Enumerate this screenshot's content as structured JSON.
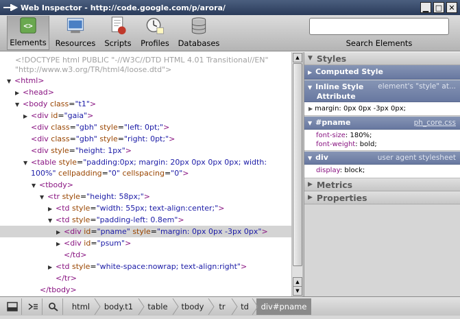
{
  "window": {
    "title": "Web Inspector - http://code.google.com/p/arora/"
  },
  "toolbar": {
    "tabs": [
      {
        "label": "Elements",
        "icon": "elements-icon"
      },
      {
        "label": "Resources",
        "icon": "resources-icon"
      },
      {
        "label": "Scripts",
        "icon": "scripts-icon"
      },
      {
        "label": "Profiles",
        "icon": "profiles-icon"
      },
      {
        "label": "Databases",
        "icon": "databases-icon"
      }
    ],
    "search_label": "Search Elements",
    "search_value": ""
  },
  "tree": {
    "doctype_1": "<!DOCTYPE html PUBLIC \"-//W3C//DTD HTML 4.01 Transitional//EN\"",
    "doctype_2": "\"http://www.w3.org/TR/html4/loose.dtd\">",
    "html": "html",
    "head": "head",
    "body": "body",
    "body_class_attr": "class",
    "body_class_val": "\"t1\"",
    "div_gaia_attr": "id",
    "div_gaia_val": "\"gaia\"",
    "gbh1_attr": "class",
    "gbh1_val": "\"gbh\"",
    "gbh1_style_attr": "style",
    "gbh1_style_val": "\"left: 0pt;\"",
    "gbh2_attr": "class",
    "gbh2_val": "\"gbh\"",
    "gbh2_style_attr": "style",
    "gbh2_style_val": "\"right: 0pt;\"",
    "div_height_attr": "style",
    "div_height_val": "\"height: 1px\"",
    "table_style_attr": "style",
    "table_style_val_1": "\"padding:0px; margin: 20px 0px 0px 0px; width:",
    "table_style_val_2": "100%\"",
    "table_cp_attr": "cellpadding",
    "table_cp_val": "\"0\"",
    "table_cs_attr": "cellspacing",
    "table_cs_val": "\"0\"",
    "tbody": "tbody",
    "tr_style_attr": "style",
    "tr_style_val": "\"height: 58px;\"",
    "td1_style_attr": "style",
    "td1_style_val": "\"width: 55px; text-align:center;\"",
    "td2_style_attr": "style",
    "td2_style_val": "\"padding-left: 0.8em\"",
    "pname_id_attr": "id",
    "pname_id_val": "\"pname\"",
    "pname_style_attr": "style",
    "pname_style_val": "\"margin: 0px 0px -3px 0px\"",
    "psum_id_attr": "id",
    "psum_id_val": "\"psum\"",
    "td_close": "/td",
    "td3_style_attr": "style",
    "td3_style_val": "\"white-space:nowrap; text-align:right\"",
    "tr_close": "/tr",
    "tbody_close": "/tbody"
  },
  "sidebar": {
    "styles_title": "Styles",
    "computed_title": "Computed Style",
    "inline_title_1": "Inline Style",
    "inline_title_2": "Attribute",
    "inline_source": "element's \"style\" at...",
    "inline_prop": "margin: 0px 0px -3px 0px;",
    "pname_title": "#pname",
    "pname_source": "ph_core.css",
    "pname_prop_1_name": "font-size",
    "pname_prop_1_value": "180%;",
    "pname_prop_2_name": "font-weight",
    "pname_prop_2_value": "bold;",
    "div_title": "div",
    "div_source": "user agent stylesheet",
    "div_prop_name": "display",
    "div_prop_value": "block;",
    "metrics_title": "Metrics",
    "properties_title": "Properties"
  },
  "statusbar": {
    "breadcrumbs": [
      "html",
      "body.t1",
      "table",
      "tbody",
      "tr",
      "td",
      "div#pname"
    ]
  },
  "colors": {
    "tag": "#881280",
    "attr_name": "#994500",
    "attr_value": "#1a1aa6",
    "selection": "#d4d4d4",
    "subhead": "#7484a8"
  }
}
